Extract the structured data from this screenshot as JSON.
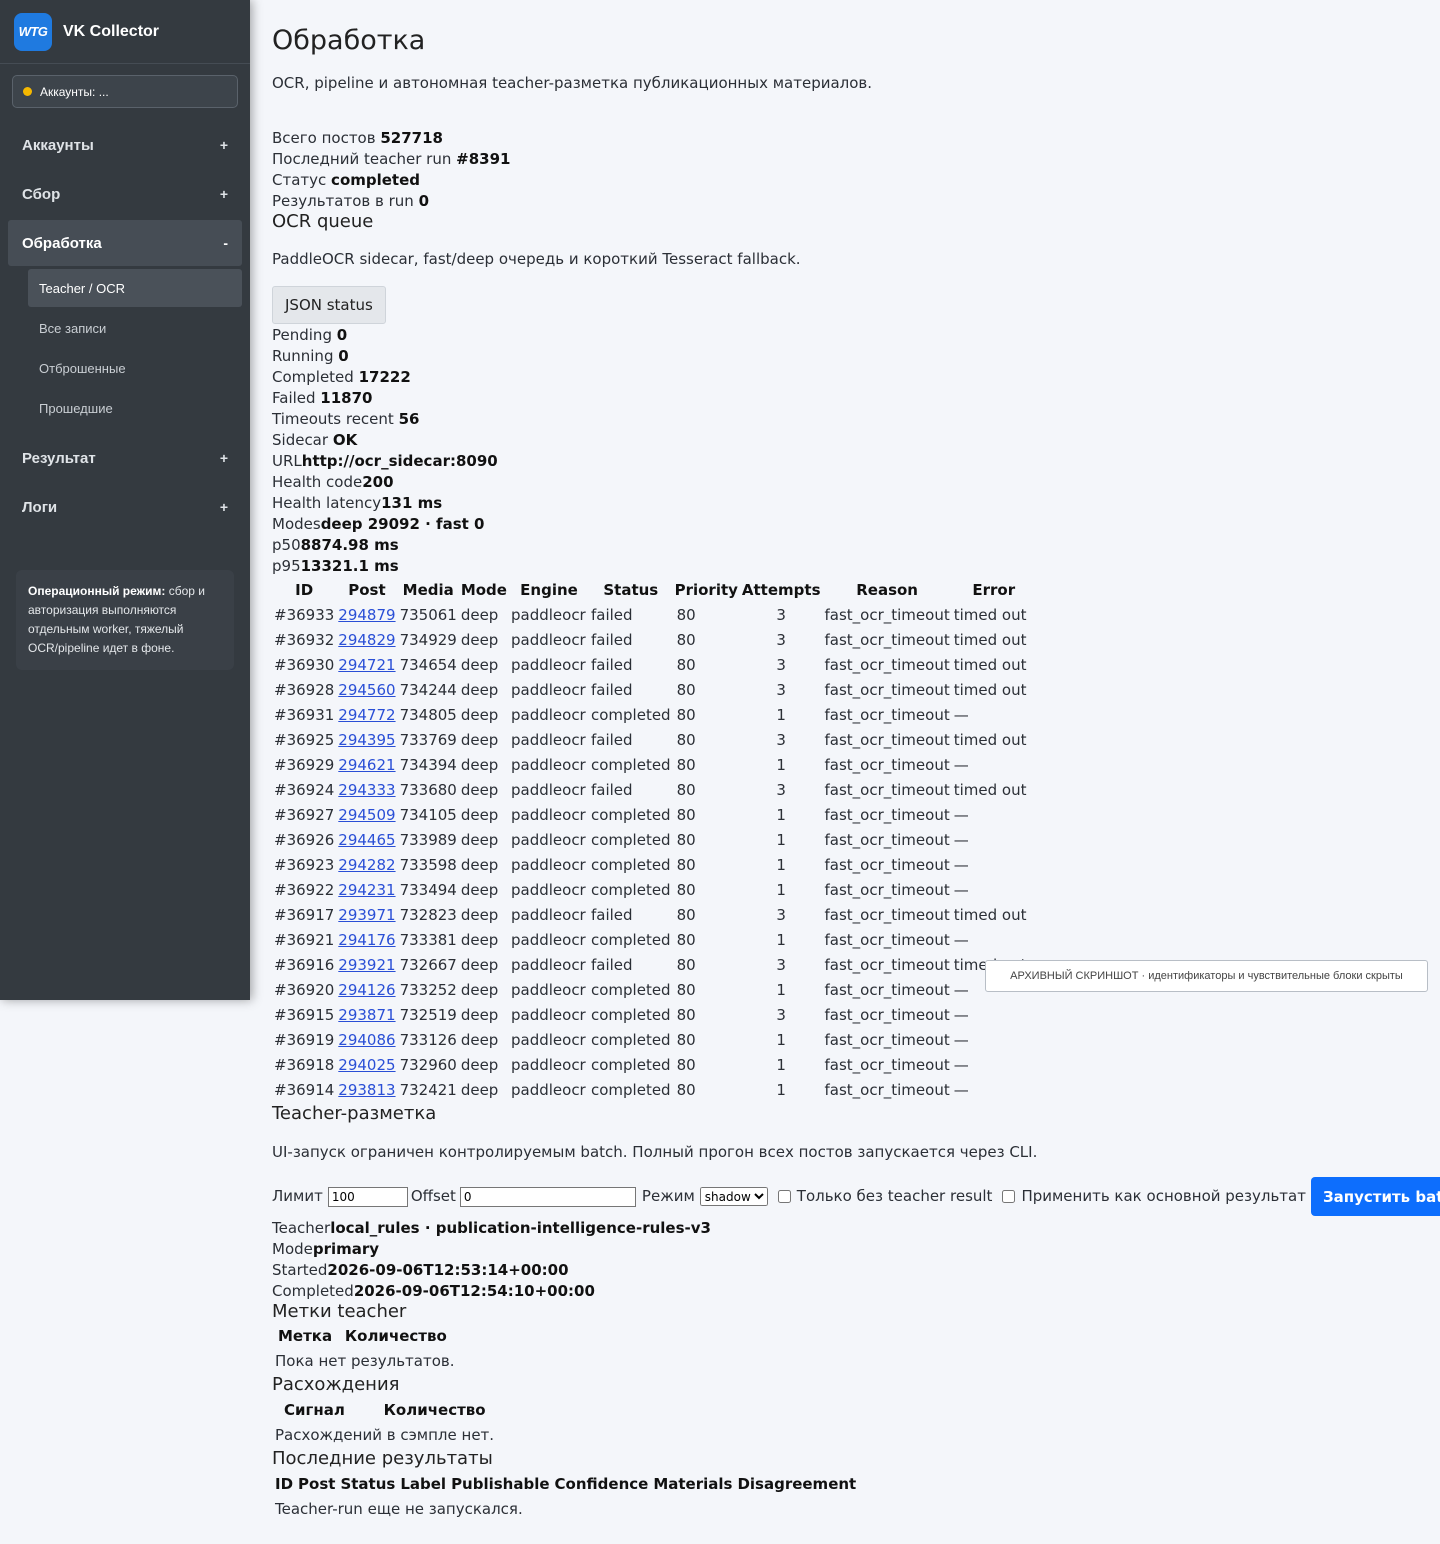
{
  "brand": {
    "logo": "WTG",
    "name": "VK Collector"
  },
  "accounts_pill": "Аккаунты: ...",
  "nav": [
    {
      "label": "Аккаунты",
      "toggle": "+"
    },
    {
      "label": "Сбор",
      "toggle": "+"
    },
    {
      "label": "Обработка",
      "toggle": "-"
    },
    {
      "label": "Результат",
      "toggle": "+"
    },
    {
      "label": "Логи",
      "toggle": "+"
    }
  ],
  "subnav": [
    "Teacher / OCR",
    "Все записи",
    "Отброшенные",
    "Прошедшие"
  ],
  "note": {
    "bold": "Операционный режим:",
    "text": " сбор и авторизация выполняются отдельным worker, тяжелый OCR/pipeline идет в фоне."
  },
  "page": {
    "title": "Обработка",
    "subtitle": "OCR, pipeline и автономная teacher-разметка публикационных материалов."
  },
  "summary": [
    {
      "label": "Всего постов ",
      "value": "527718"
    },
    {
      "label": "Последний teacher run ",
      "value": "#8391"
    },
    {
      "label": "Статус ",
      "value": "completed"
    },
    {
      "label": "Результатов в run ",
      "value": "0"
    }
  ],
  "ocr": {
    "title": "OCR queue",
    "desc": "PaddleOCR sidecar, fast/deep очередь и короткий Tesseract fallback.",
    "json_button": "JSON status",
    "stats": [
      {
        "label": "Pending ",
        "value": "0"
      },
      {
        "label": "Running ",
        "value": "0"
      },
      {
        "label": "Completed ",
        "value": "17222"
      },
      {
        "label": "Failed ",
        "value": "11870"
      },
      {
        "label": "Timeouts recent ",
        "value": "56"
      },
      {
        "label": "Sidecar ",
        "value": "OK"
      },
      {
        "label": "URL",
        "value": "http://ocr_sidecar:8090"
      },
      {
        "label": "Health code",
        "value": "200"
      },
      {
        "label": "Health latency",
        "value": "131 ms"
      },
      {
        "label": "Modes",
        "value": "deep 29092 · fast 0"
      },
      {
        "label": "p50",
        "value": "8874.98 ms"
      },
      {
        "label": "p95",
        "value": "13321.1 ms"
      }
    ],
    "columns": [
      "ID",
      "Post",
      "Media",
      "Mode",
      "Engine",
      "Status",
      "Priority",
      "Attempts",
      "Reason",
      "Error"
    ],
    "rows": [
      [
        "#36933",
        "294879",
        "735061",
        "deep",
        "paddleocr",
        "failed",
        "80",
        "3",
        "fast_ocr_timeout",
        "timed out"
      ],
      [
        "#36932",
        "294829",
        "734929",
        "deep",
        "paddleocr",
        "failed",
        "80",
        "3",
        "fast_ocr_timeout",
        "timed out"
      ],
      [
        "#36930",
        "294721",
        "734654",
        "deep",
        "paddleocr",
        "failed",
        "80",
        "3",
        "fast_ocr_timeout",
        "timed out"
      ],
      [
        "#36928",
        "294560",
        "734244",
        "deep",
        "paddleocr",
        "failed",
        "80",
        "3",
        "fast_ocr_timeout",
        "timed out"
      ],
      [
        "#36931",
        "294772",
        "734805",
        "deep",
        "paddleocr",
        "completed",
        "80",
        "1",
        "fast_ocr_timeout",
        "—"
      ],
      [
        "#36925",
        "294395",
        "733769",
        "deep",
        "paddleocr",
        "failed",
        "80",
        "3",
        "fast_ocr_timeout",
        "timed out"
      ],
      [
        "#36929",
        "294621",
        "734394",
        "deep",
        "paddleocr",
        "completed",
        "80",
        "1",
        "fast_ocr_timeout",
        "—"
      ],
      [
        "#36924",
        "294333",
        "733680",
        "deep",
        "paddleocr",
        "failed",
        "80",
        "3",
        "fast_ocr_timeout",
        "timed out"
      ],
      [
        "#36927",
        "294509",
        "734105",
        "deep",
        "paddleocr",
        "completed",
        "80",
        "1",
        "fast_ocr_timeout",
        "—"
      ],
      [
        "#36926",
        "294465",
        "733989",
        "deep",
        "paddleocr",
        "completed",
        "80",
        "1",
        "fast_ocr_timeout",
        "—"
      ],
      [
        "#36923",
        "294282",
        "733598",
        "deep",
        "paddleocr",
        "completed",
        "80",
        "1",
        "fast_ocr_timeout",
        "—"
      ],
      [
        "#36922",
        "294231",
        "733494",
        "deep",
        "paddleocr",
        "completed",
        "80",
        "1",
        "fast_ocr_timeout",
        "—"
      ],
      [
        "#36917",
        "293971",
        "732823",
        "deep",
        "paddleocr",
        "failed",
        "80",
        "3",
        "fast_ocr_timeout",
        "timed out"
      ],
      [
        "#36921",
        "294176",
        "733381",
        "deep",
        "paddleocr",
        "completed",
        "80",
        "1",
        "fast_ocr_timeout",
        "—"
      ],
      [
        "#36916",
        "293921",
        "732667",
        "deep",
        "paddleocr",
        "failed",
        "80",
        "3",
        "fast_ocr_timeout",
        "timed out"
      ],
      [
        "#36920",
        "294126",
        "733252",
        "deep",
        "paddleocr",
        "completed",
        "80",
        "1",
        "fast_ocr_timeout",
        "—"
      ],
      [
        "#36915",
        "293871",
        "732519",
        "deep",
        "paddleocr",
        "completed",
        "80",
        "3",
        "fast_ocr_timeout",
        "—"
      ],
      [
        "#36919",
        "294086",
        "733126",
        "deep",
        "paddleocr",
        "completed",
        "80",
        "1",
        "fast_ocr_timeout",
        "—"
      ],
      [
        "#36918",
        "294025",
        "732960",
        "deep",
        "paddleocr",
        "completed",
        "80",
        "1",
        "fast_ocr_timeout",
        "—"
      ],
      [
        "#36914",
        "293813",
        "732421",
        "deep",
        "paddleocr",
        "completed",
        "80",
        "1",
        "fast_ocr_timeout",
        "—"
      ]
    ]
  },
  "archive_note": "АРХИВНЫЙ СКРИНШОТ · идентификаторы и чувствительные блоки скрыты",
  "teacher": {
    "title": "Teacher-разметка",
    "desc": "UI-запуск ограничен контролируемым batch. Полный прогон всех постов запускается через CLI.",
    "limit_label": "Лимит",
    "limit_value": "100",
    "offset_label": "Offset",
    "offset_value": "0",
    "mode_label": "Режим",
    "mode_value": "shadow",
    "only_without_label": "Только без teacher result",
    "apply_primary_label": "Применить как основной результат",
    "run_button": "Запустить batch",
    "info": [
      {
        "label": "Teacher",
        "value": "local_rules · publication-intelligence-rules-v3"
      },
      {
        "label": "Mode",
        "value": "primary"
      },
      {
        "label": "Started",
        "value": "2026-09-06T12:53:14+00:00"
      },
      {
        "label": "Completed",
        "value": "2026-09-06T12:54:10+00:00"
      }
    ]
  },
  "labels": {
    "title": "Метки teacher",
    "col1": "Метка",
    "col2": "Количество",
    "empty": "Пока нет результатов."
  },
  "disagreements": {
    "title": "Расхождения",
    "col1": "Сигнал",
    "col2": "Количество",
    "empty": "Расхождений в сэмпле нет."
  },
  "recent": {
    "title": "Последние результаты",
    "columns": [
      "ID",
      "Post",
      "Status",
      "Label",
      "Publishable",
      "Confidence",
      "Materials",
      "Disagreement"
    ],
    "empty": "Teacher-run еще не запускался."
  }
}
